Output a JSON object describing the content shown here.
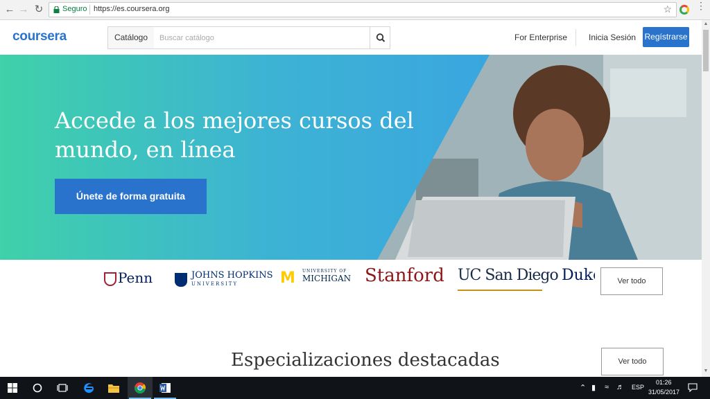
{
  "browser": {
    "secure_label": "Seguro",
    "url": "https://es.coursera.org"
  },
  "header": {
    "logo": "coursera",
    "catalog_label": "Catálogo",
    "search_placeholder": "Buscar catálogo",
    "enterprise_label": "For Enterprise",
    "login_label": "Inicia Sesión",
    "register_label": "Regístrarse",
    "brand_color": "#2a73cc"
  },
  "hero": {
    "title": "Accede a los mejores cursos del mundo, en línea",
    "cta_label": "Únete de forma gratuita"
  },
  "partners": {
    "penn": "Penn",
    "jhu": "JOHNS HOPKINS",
    "jhu_sub": "UNIVERSITY",
    "umich_m": "M",
    "umich_small": "UNIVERSITY OF",
    "umich": "MICHIGAN",
    "stanford": "Stanford",
    "ucsd": "UC San Diego",
    "duke": "Duke",
    "see_all": "Ver todo"
  },
  "specializations": {
    "title": "Especializaciones destacadas",
    "see_all": "Ver todo"
  },
  "taskbar": {
    "language": "ESP",
    "time": "01:26",
    "date": "31/05/2017"
  }
}
